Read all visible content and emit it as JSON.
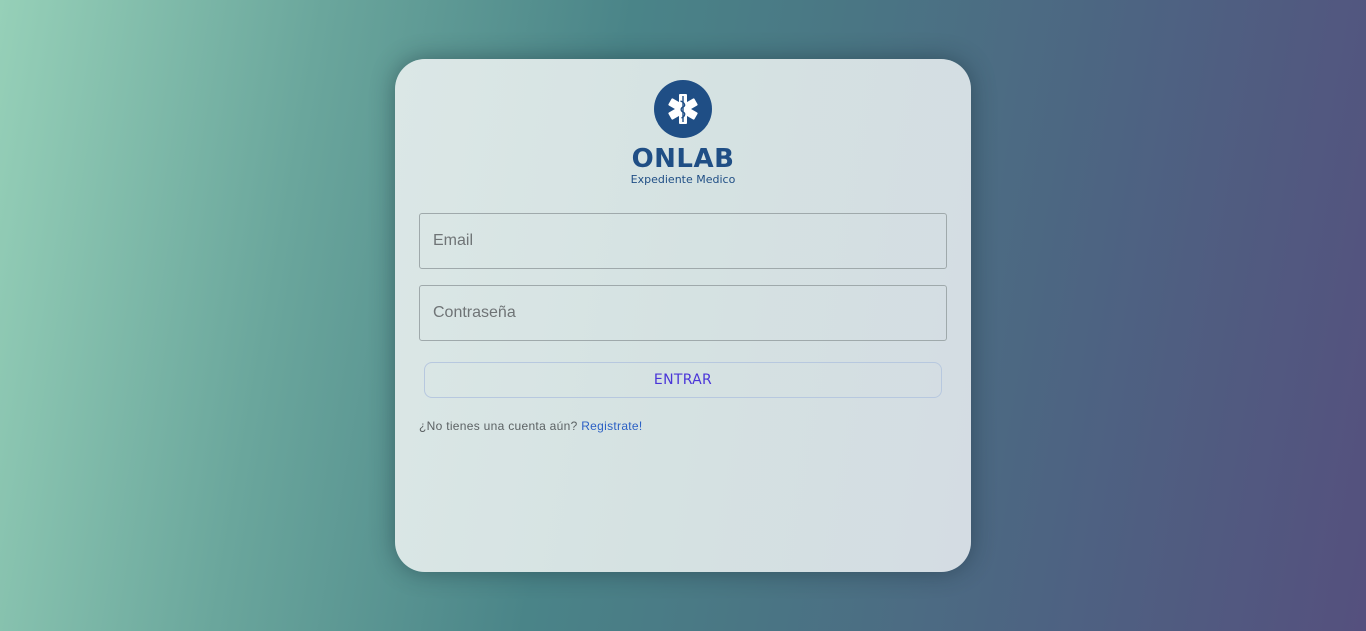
{
  "brand": {
    "name": "ONLAB",
    "subtitle": "Expediente Medico",
    "logo_icon": "star-of-life-icon",
    "color": "#1f4e85"
  },
  "login": {
    "email_placeholder": "Email",
    "email_value": "",
    "password_placeholder": "Contraseña",
    "password_value": "",
    "submit_label": "ENTRAR",
    "register_prompt": "¿No tienes una cuenta aún?",
    "register_link": "Registrate!"
  },
  "colors": {
    "accent": "#4a35d8",
    "link": "#2a5fc4"
  }
}
